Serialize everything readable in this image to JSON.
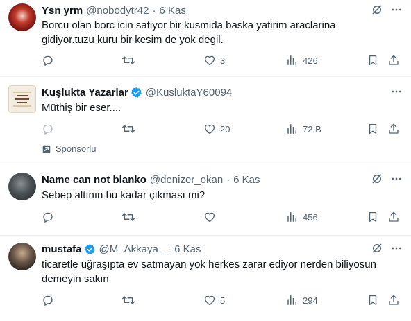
{
  "tweets": [
    {
      "name": "Ysn yrm",
      "handle": "@nobodytr42",
      "separator": "·",
      "time": "6 Kas",
      "text": "Borcu olan borc icin satiyor bir kusmida baska yatirim araclarina gidiyor.tuzu kuru bir kesim de yok degil.",
      "likes": "3",
      "views": "426"
    },
    {
      "name": "Kuşlukta Yazarlar",
      "handle": "@KusluktaY60094",
      "text": "Müthiş bir eser....",
      "likes": "20",
      "views": "72 B",
      "sponsored_label": "Sponsorlu",
      "avatar_text": "Bonum\nYarna\nSanatı"
    },
    {
      "name": "Name can not blanko",
      "handle": "@denizer_okan",
      "separator": "·",
      "time": "6 Kas",
      "text": "Sebep altının bu kadar çıkması mi?",
      "likes": "",
      "views": "456"
    },
    {
      "name": "mustafa",
      "handle": "@M_Akkaya_",
      "separator": "·",
      "time": "6 Kas",
      "text": "ticaretle uğraşıpta ev satmayan yok herkes zarar ediyor nerden biliyosun demeyin sakın",
      "likes": "5",
      "views": "294"
    }
  ],
  "colors": {
    "text": "#0f1419",
    "muted": "#536471",
    "verified": "#1d9bf0",
    "border": "#eff3f4"
  },
  "icons": [
    "grok-icon",
    "more-icon",
    "reply-icon",
    "retweet-icon",
    "like-icon",
    "views-icon",
    "bookmark-icon",
    "share-icon",
    "sponsored-icon",
    "verified-icon"
  ]
}
